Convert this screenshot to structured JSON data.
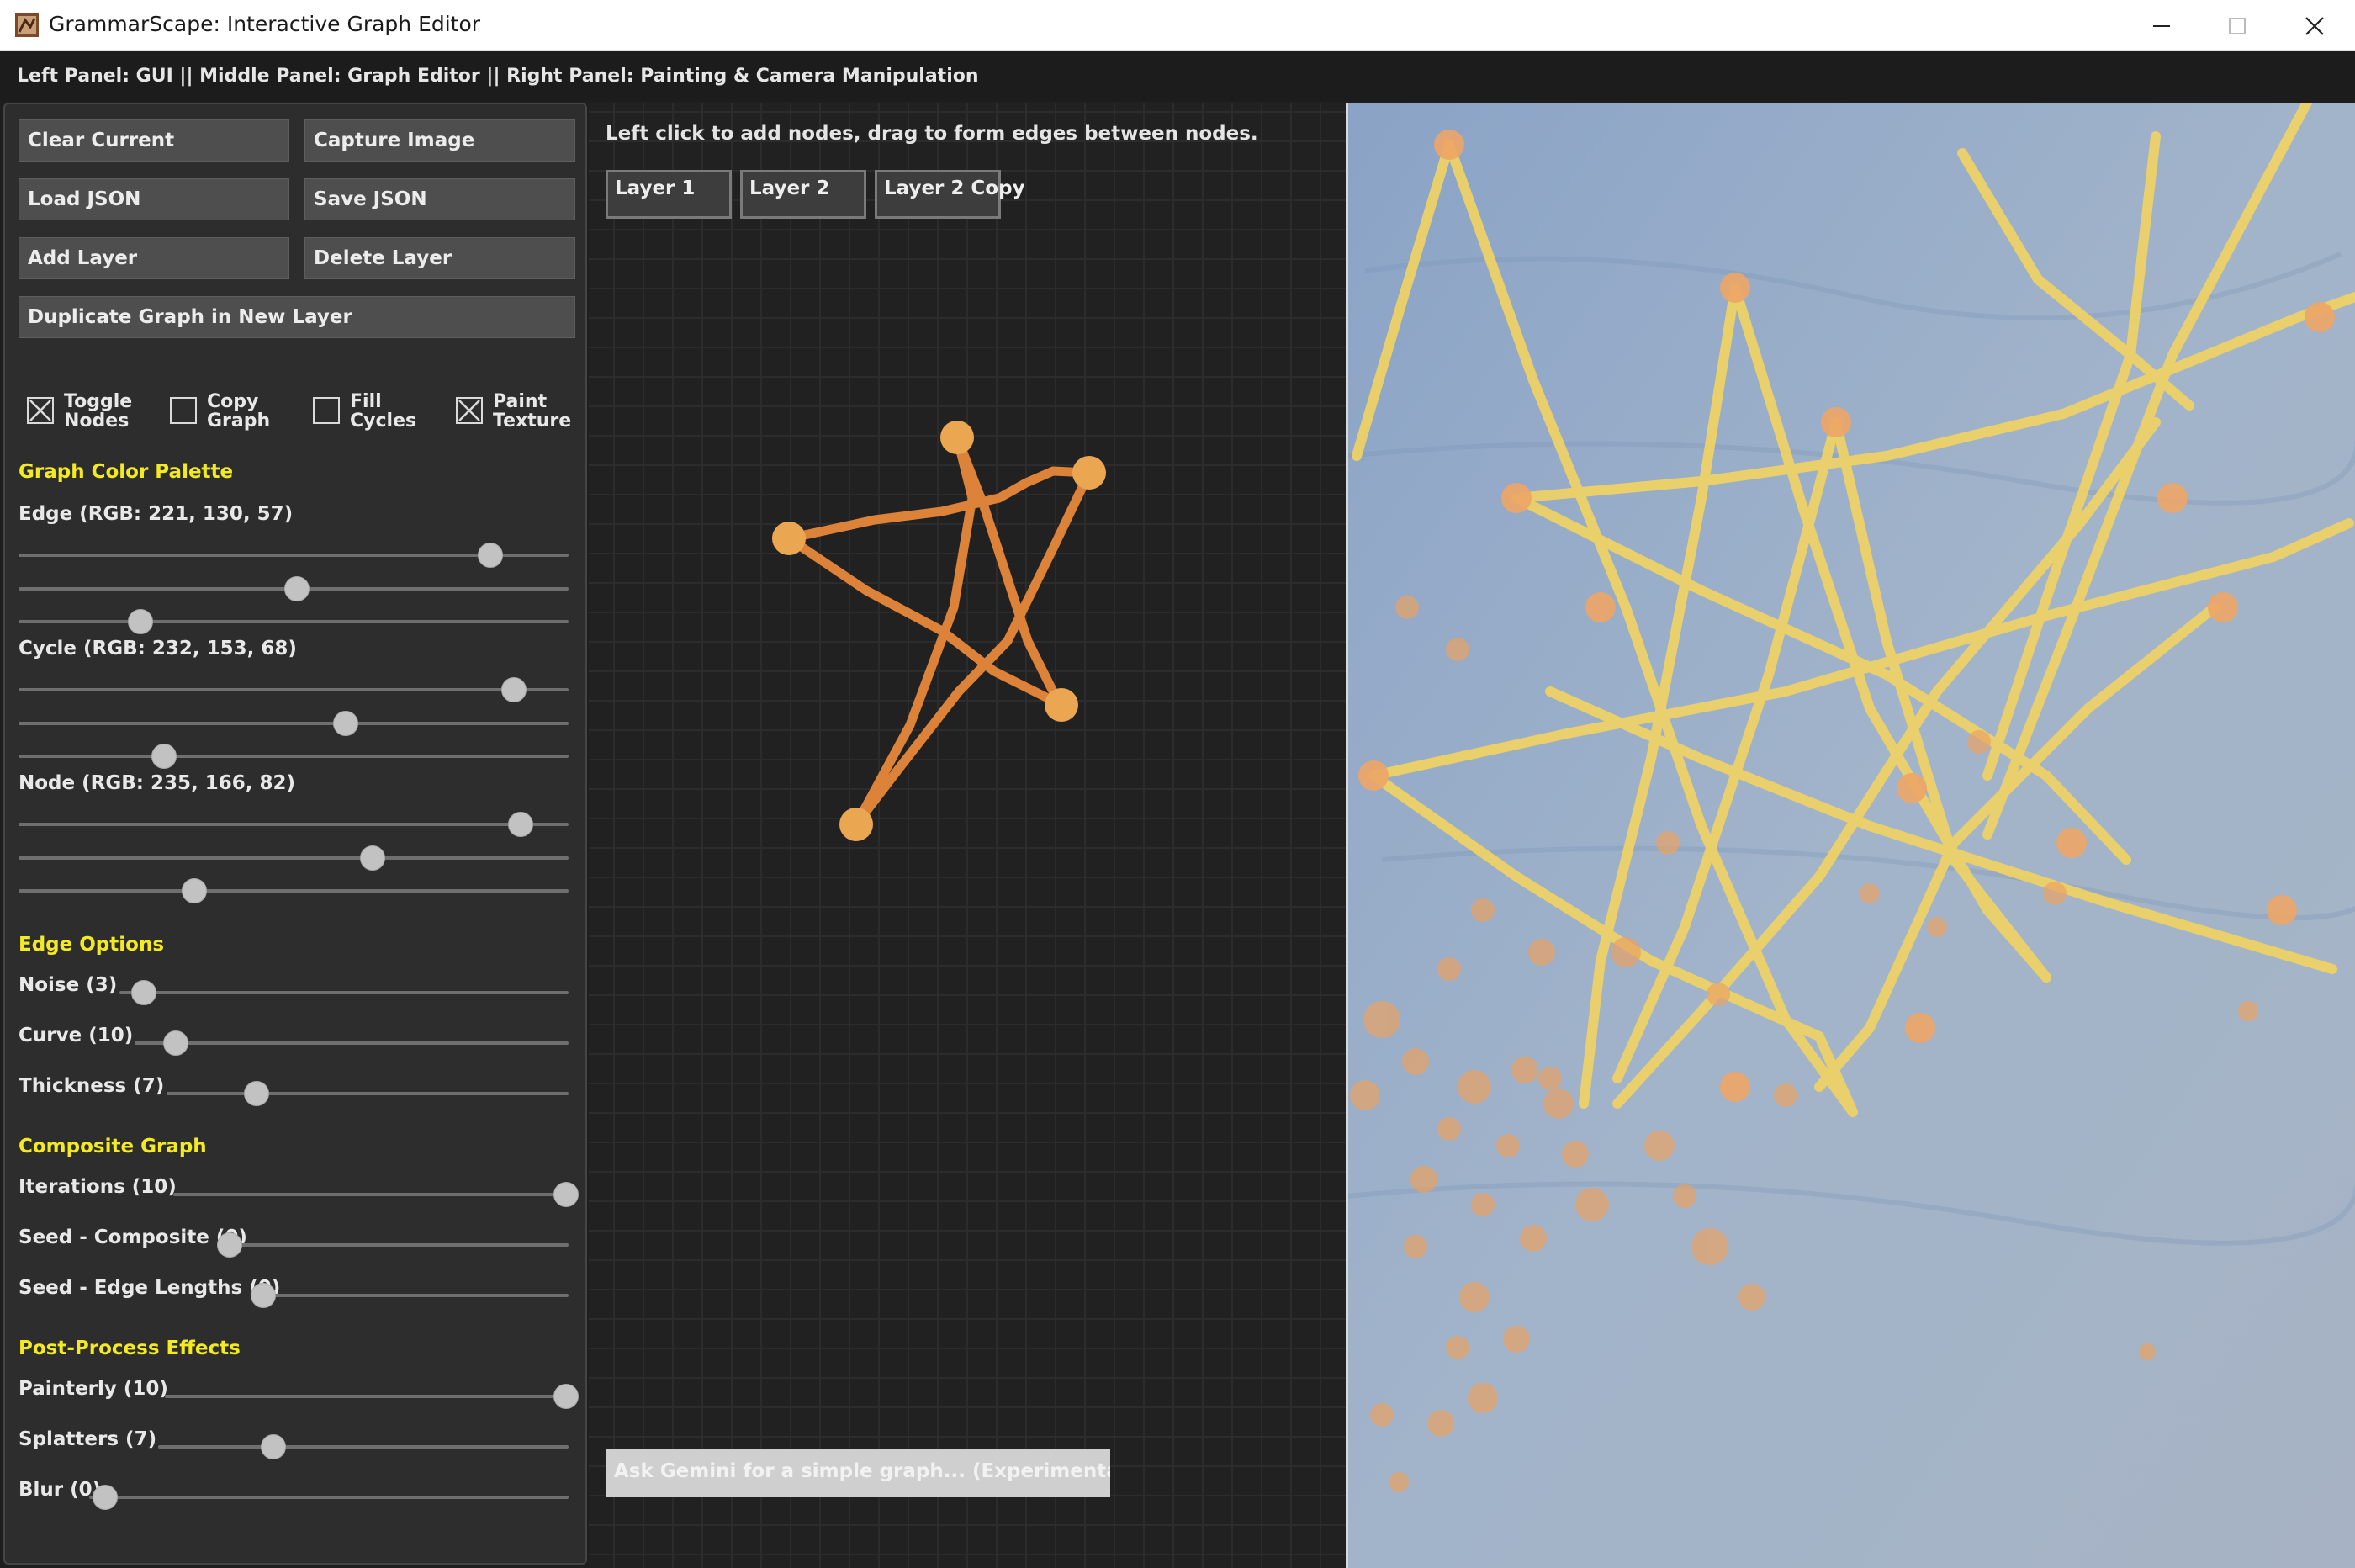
{
  "window": {
    "title": "GrammarScape: Interactive Graph Editor",
    "controls": [
      "minimize",
      "maximize",
      "close"
    ]
  },
  "infobar": {
    "text": "Left Panel: GUI || Middle Panel: Graph Editor || Right Panel: Painting & Camera Manipulation"
  },
  "buttons": {
    "clear_current": "Clear Current",
    "capture_image": "Capture Image",
    "load_json": "Load JSON",
    "save_json": "Save JSON",
    "add_layer": "Add Layer",
    "delete_layer": "Delete Layer",
    "duplicate_graph": "Duplicate Graph in New Layer"
  },
  "toggles": [
    {
      "label": "Toggle Nodes",
      "checked": true
    },
    {
      "label": "Copy Graph",
      "checked": false
    },
    {
      "label": "Fill Cycles",
      "checked": false
    },
    {
      "label": "Paint Texture",
      "checked": true
    }
  ],
  "palette": {
    "heading": "Graph Color Palette",
    "edge": {
      "label": "Edge (RGB: 221, 130, 57)",
      "rgb": [
        221,
        130,
        57
      ]
    },
    "cycle": {
      "label": "Cycle (RGB: 232, 153, 68)",
      "rgb": [
        232,
        153,
        68
      ]
    },
    "node": {
      "label": "Node (RGB: 235, 166, 82)",
      "rgb": [
        235,
        166,
        82
      ]
    }
  },
  "edge_options": {
    "heading": "Edge Options",
    "noise": {
      "label": "Noise (3)",
      "value": 3,
      "max": 100
    },
    "curve": {
      "label": "Curve (10)",
      "value": 10,
      "max": 100
    },
    "thickness": {
      "label": "Thickness (7)",
      "value": 7,
      "max": 30
    }
  },
  "composite": {
    "heading": "Composite Graph",
    "iterations": {
      "label": "Iterations (10)",
      "value": 10,
      "max": 10
    },
    "seed_composite": {
      "label": "Seed - Composite (0)",
      "value": 0,
      "max": 100
    },
    "seed_edge_lengths": {
      "label": "Seed - Edge Lengths (0)",
      "value": 0,
      "max": 100
    }
  },
  "post_process": {
    "heading": "Post-Process Effects",
    "painterly": {
      "label": "Painterly (10)",
      "value": 10,
      "max": 10
    },
    "splatters": {
      "label": "Splatters (7)",
      "value": 7,
      "max": 25
    },
    "blur": {
      "label": "Blur (0)",
      "value": 0,
      "max": 10
    }
  },
  "editor": {
    "hint": "Left click to add nodes, drag to form edges between nodes.",
    "layers": [
      "Layer 1",
      "Layer 2",
      "Layer 2 Copy"
    ],
    "gemini_placeholder": "Ask Gemini for a simple graph... (Experimental)"
  },
  "colors": {
    "edge": "#dd8239",
    "node": "#eba652",
    "section_heading": "#f3ea22",
    "canvas_background": "#9aaec4",
    "painted_edge": "#f2d462",
    "painted_node": "#eda566"
  },
  "icons": {
    "app": "app-icon",
    "minimize": "minimize-icon",
    "maximize": "maximize-icon",
    "close": "close-icon",
    "checked": "checkbox-checked-icon",
    "unchecked": "checkbox-unchecked-icon"
  }
}
